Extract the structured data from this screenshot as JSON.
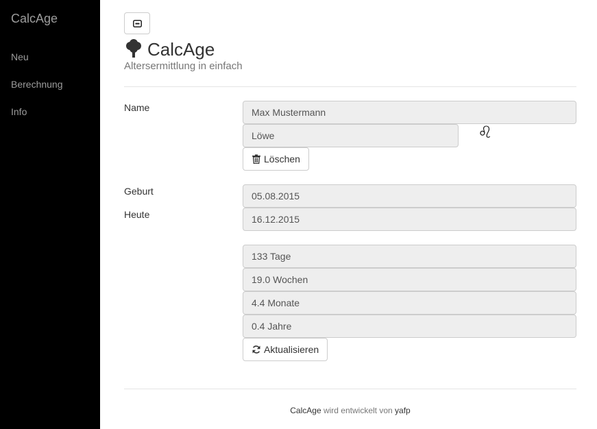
{
  "sidebar": {
    "brand": "CalcAge",
    "items": [
      {
        "label": "Neu"
      },
      {
        "label": "Berechnung"
      },
      {
        "label": "Info"
      }
    ]
  },
  "header": {
    "title": "CalcAge",
    "subtitle": "Altersermittlung in einfach",
    "icon": "tree-icon"
  },
  "form": {
    "name_label": "Name",
    "name_value": "Max Mustermann",
    "sign_value": "Löwe",
    "sign_symbol": "♌",
    "delete_label": "Löschen",
    "birth_label": "Geburt",
    "birth_value": "05.08.2015",
    "today_label": "Heute",
    "today_value": "16.12.2015",
    "days": "133 Tage",
    "weeks": "19.0 Wochen",
    "months": "4.4 Monate",
    "years": "0.4 Jahre",
    "refresh_label": "Aktualisieren"
  },
  "footer": {
    "app": "CalcAge",
    "text": "wird entwickelt von",
    "author": "yafp"
  }
}
